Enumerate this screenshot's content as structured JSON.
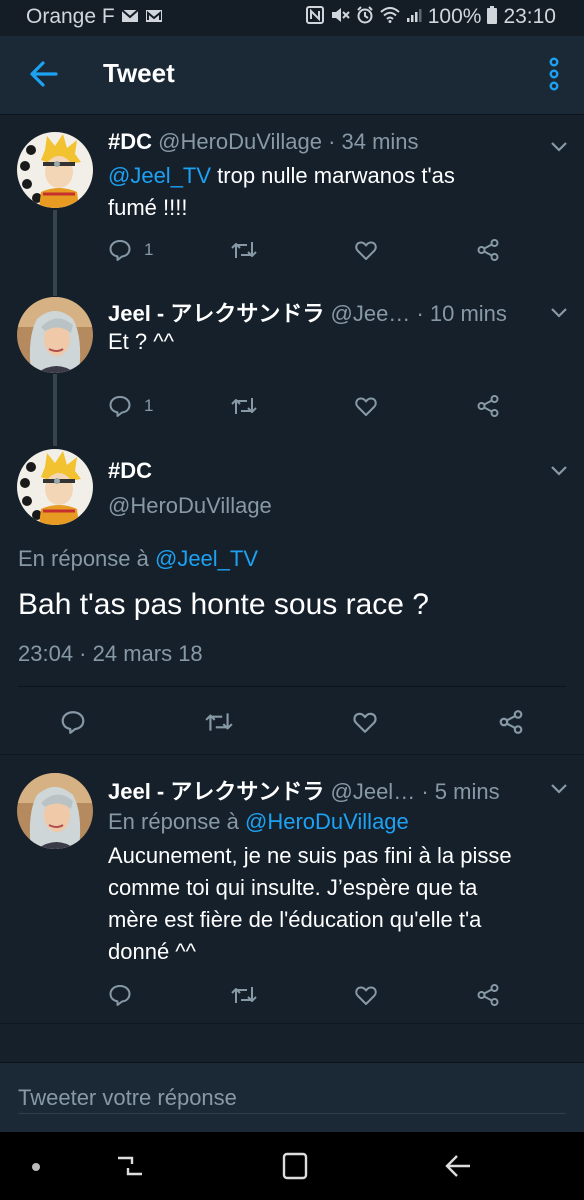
{
  "status_bar": {
    "carrier": "Orange F",
    "battery": "100%",
    "time": "23:10"
  },
  "app_bar": {
    "title": "Tweet"
  },
  "tweets": [
    {
      "name": "#DC",
      "handle": "@HeroDuVillage",
      "time": "· 34 mins",
      "mention": "@Jeel_TV",
      "text_line1": " trop nulle marwanos t'as",
      "text_line2": "fumé !!!!",
      "reply_count": "1"
    },
    {
      "name": "Jeel - アレクサンドラ",
      "handle": "@Jee…",
      "time": "· 10 mins",
      "text": "Et ? ^^",
      "reply_count": "1"
    }
  ],
  "focused_tweet": {
    "name": "#DC",
    "handle": "@HeroDuVillage",
    "reply_prefix": "En réponse à ",
    "reply_to": "@Jeel_TV",
    "text": "Bah t'as pas honte sous race ?",
    "timestamp": "23:04 · 24 mars 18"
  },
  "reply_tweet": {
    "name": "Jeel - アレクサンドラ",
    "handle": "@Jeel…",
    "time": "· 5 mins",
    "reply_prefix": "En réponse à ",
    "reply_to": "@HeroDuVillage",
    "text_lines": [
      "Aucunement, je ne suis pas fini à la pisse",
      "comme toi qui insulte. J’espère que ta",
      "mère est fière de l'éducation qu'elle t'a",
      "donné ^^"
    ]
  },
  "composer": {
    "placeholder": "Tweeter votre réponse"
  },
  "colors": {
    "background": "#15202b",
    "header": "#1b2836",
    "accent": "#1da1f2",
    "muted": "#8899a6"
  }
}
